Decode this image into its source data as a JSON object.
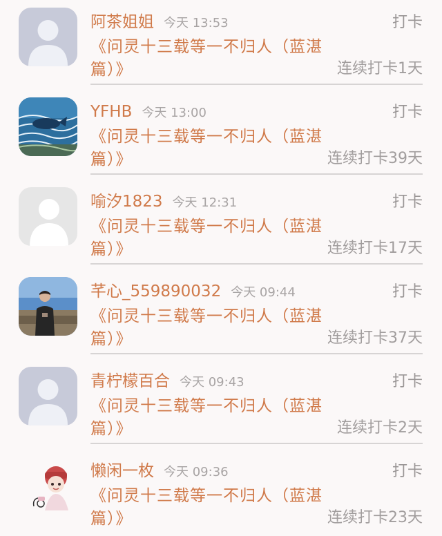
{
  "feed": {
    "items": [
      {
        "name": "阿茶姐姐",
        "time": "今天 13:53",
        "action": "打卡",
        "content": "《问灵十三载等一不归人（蓝湛篇）》",
        "streak": "连续打卡1天",
        "avatar_icon": "default-avatar-icon"
      },
      {
        "name": "YFHB",
        "time": "今天 13:00",
        "action": "打卡",
        "content": "《问灵十三载等一不归人（蓝湛篇）》",
        "streak": "连续打卡39天",
        "avatar_icon": "whale-painting-avatar"
      },
      {
        "name": "喻汐1823",
        "time": "今天 12:31",
        "action": "打卡",
        "content": "《问灵十三载等一不归人（蓝湛篇）》",
        "streak": "连续打卡17天",
        "avatar_icon": "silhouette-avatar-icon"
      },
      {
        "name": "芊心_559890032",
        "time": "今天 09:44",
        "action": "打卡",
        "content": "《问灵十三载等一不归人（蓝湛篇）》",
        "streak": "连续打卡37天",
        "avatar_icon": "photo-avatar"
      },
      {
        "name": "青柠檬百合",
        "time": "今天 09:43",
        "action": "打卡",
        "content": "《问灵十三载等一不归人（蓝湛篇）》",
        "streak": "连续打卡2天",
        "avatar_icon": "default-avatar-icon"
      },
      {
        "name": "懒闲一枚",
        "time": "今天 09:36",
        "action": "打卡",
        "content": "《问灵十三载等一不归人（蓝湛篇）》",
        "streak": "连续打卡23天",
        "avatar_icon": "cartoon-avatar"
      }
    ]
  },
  "colors": {
    "accent": "#d07a4a",
    "muted": "#a19d9d",
    "background": "#fbf8f8"
  }
}
